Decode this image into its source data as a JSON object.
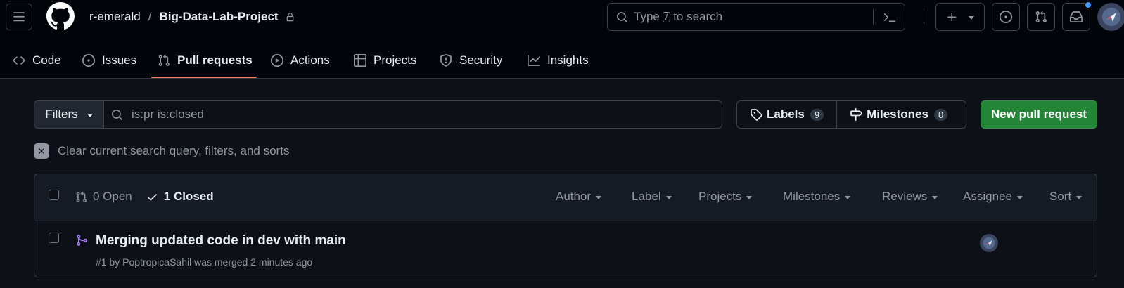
{
  "header": {
    "owner": "r-emerald",
    "separator": "/",
    "repo": "Big-Data-Lab-Project",
    "search": {
      "prefix": "Type",
      "key": "/",
      "suffix": "to search"
    }
  },
  "nav": {
    "tabs": [
      {
        "label": "Code",
        "icon": "code-icon"
      },
      {
        "label": "Issues",
        "icon": "issue-opened-icon"
      },
      {
        "label": "Pull requests",
        "icon": "git-pull-request-icon",
        "active": true
      },
      {
        "label": "Actions",
        "icon": "play-icon"
      },
      {
        "label": "Projects",
        "icon": "table-icon"
      },
      {
        "label": "Security",
        "icon": "shield-icon"
      },
      {
        "label": "Insights",
        "icon": "graph-icon"
      }
    ]
  },
  "toolbar": {
    "filters_label": "Filters",
    "search_value": "is:pr is:closed",
    "labels_label": "Labels",
    "labels_count": "9",
    "milestones_label": "Milestones",
    "milestones_count": "0",
    "new_pr_label": "New pull request",
    "clear_query_label": "Clear current search query, filters, and sorts"
  },
  "list": {
    "open_label": "0 Open",
    "closed_label": "1 Closed",
    "filters": [
      "Author",
      "Label",
      "Projects",
      "Milestones",
      "Reviews",
      "Assignee",
      "Sort"
    ],
    "items": [
      {
        "title": "Merging updated code in dev with main",
        "meta": "#1 by PoptropicaSahil was merged 2 minutes ago",
        "state_icon": "git-merge-icon"
      }
    ]
  },
  "colors": {
    "accent_green": "#238636",
    "merged_purple": "#ab7df8",
    "tab_underline": "#f78166",
    "notification_blue": "#4493f8"
  }
}
